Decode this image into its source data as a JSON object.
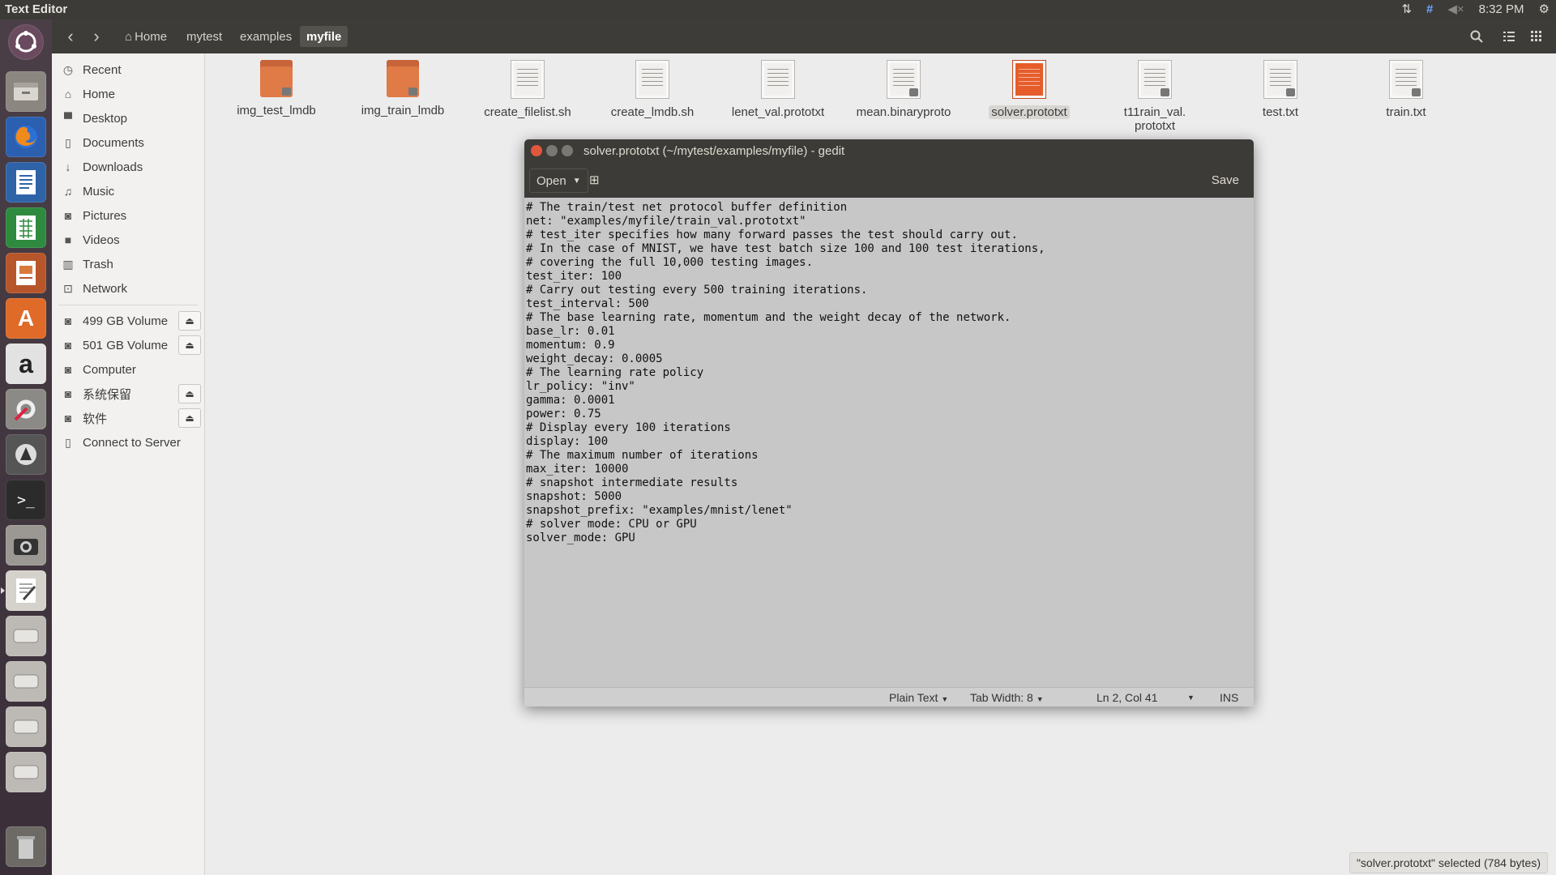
{
  "top_panel": {
    "app_title": "Text Editor",
    "time": "8:32 PM",
    "indicators": {
      "transfer": "⇅",
      "network": "#",
      "volume": "◀×",
      "settings": "⚙"
    }
  },
  "launcher": {
    "items": [
      "dash-home",
      "files",
      "firefox",
      "libreoffice-writer",
      "libreoffice-calc",
      "libreoffice-impress",
      "software-center",
      "amazon",
      "system-settings",
      "software-updater",
      "terminal",
      "camera",
      "text-editor",
      "disk-1",
      "disk-2",
      "disk-3",
      "disk-4",
      "trash"
    ],
    "glyphs": {
      "amazon": "a",
      "terminal": ">_",
      "software-center": "A"
    }
  },
  "file_manager": {
    "breadcrumbs": [
      {
        "label": "Home",
        "active": false
      },
      {
        "label": "mytest",
        "active": false
      },
      {
        "label": "examples",
        "active": false
      },
      {
        "label": "myfile",
        "active": true
      }
    ],
    "home_glyph": "⌂",
    "sidebar": {
      "places": [
        {
          "label": "Recent",
          "icon": "clock-icon",
          "glyph": "◷"
        },
        {
          "label": "Home",
          "icon": "home-icon",
          "glyph": "⌂"
        },
        {
          "label": "Desktop",
          "icon": "desktop-icon",
          "glyph": "▀"
        },
        {
          "label": "Documents",
          "icon": "document-icon",
          "glyph": "▯"
        },
        {
          "label": "Downloads",
          "icon": "download-icon",
          "glyph": "↓"
        },
        {
          "label": "Music",
          "icon": "music-icon",
          "glyph": "♫"
        },
        {
          "label": "Pictures",
          "icon": "camera-icon",
          "glyph": "◙"
        },
        {
          "label": "Videos",
          "icon": "video-icon",
          "glyph": "■"
        },
        {
          "label": "Trash",
          "icon": "trash-icon",
          "glyph": "▥"
        },
        {
          "label": "Network",
          "icon": "network-icon",
          "glyph": "⊡"
        }
      ],
      "devices": [
        {
          "label": "499 GB Volume",
          "eject": true
        },
        {
          "label": "501 GB Volume",
          "eject": true
        },
        {
          "label": "Computer",
          "eject": false
        },
        {
          "label": "系统保留",
          "eject": true
        },
        {
          "label": "软件",
          "eject": true
        },
        {
          "label": "Connect to Server",
          "eject": false
        }
      ]
    },
    "files": [
      {
        "name": "img_test_lmdb",
        "kind": "folder"
      },
      {
        "name": "img_train_lmdb",
        "kind": "folder"
      },
      {
        "name": "create_filelist.sh",
        "kind": "doc"
      },
      {
        "name": "create_lmdb.sh",
        "kind": "doc"
      },
      {
        "name": "lenet_val.prototxt",
        "kind": "doc"
      },
      {
        "name": "mean.binaryproto",
        "kind": "doc"
      },
      {
        "name": "solver.prototxt",
        "kind": "doc-selected"
      },
      {
        "name": "t11rain_val.\nprototxt",
        "kind": "doc"
      },
      {
        "name": "test.txt",
        "kind": "doc"
      },
      {
        "name": "train.txt",
        "kind": "doc"
      }
    ],
    "status_text": "\"solver.prototxt\" selected  (784 bytes)"
  },
  "gedit": {
    "window_title": "solver.prototxt (~/mytest/examples/myfile) - gedit",
    "open_label": "Open",
    "save_label": "Save",
    "new_tab_glyph": "⊞",
    "lines": [
      "# The train/test net protocol buffer definition",
      "net: \"examples/myfile/train_val.prototxt\"",
      "# test_iter specifies how many forward passes the test should carry out.",
      "# In the case of MNIST, we have test batch size 100 and 100 test iterations,",
      "# covering the full 10,000 testing images.",
      "test_iter: 100",
      "# Carry out testing every 500 training iterations.",
      "test_interval: 500",
      "# The base learning rate, momentum and the weight decay of the network.",
      "base_lr: 0.01",
      "momentum: 0.9",
      "weight_decay: 0.0005",
      "# The learning rate policy",
      "lr_policy: \"inv\"",
      "gamma: 0.0001",
      "power: 0.75",
      "# Display every 100 iterations",
      "display: 100",
      "# The maximum number of iterations",
      "max_iter: 10000",
      "# snapshot intermediate results",
      "snapshot: 5000",
      "snapshot_prefix: \"examples/mnist/lenet\"",
      "# solver mode: CPU or GPU",
      "solver_mode: GPU"
    ],
    "status": {
      "language": "Plain Text",
      "tab_width": "Tab Width: 8",
      "position": "Ln 2, Col 41",
      "mode": "INS"
    }
  }
}
